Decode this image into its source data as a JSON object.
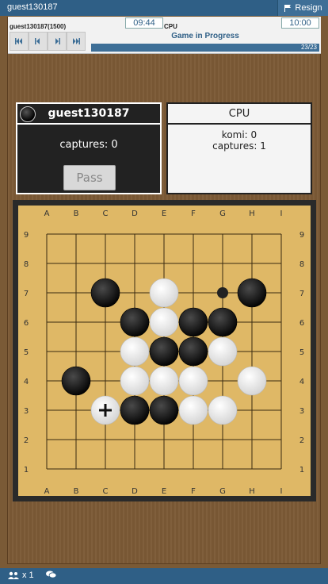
{
  "topbar": {
    "username": "guest130187",
    "resign_label": "Resign"
  },
  "header": {
    "player_name": "guest130187(1500)",
    "opponent_name": "CPU",
    "player_clock": "09:44",
    "opponent_clock": "10:00",
    "status": "Game in Progress",
    "move_counter": "23/23",
    "progress": 1.0
  },
  "player_panel": {
    "name": "guest130187",
    "captures": "captures: 0",
    "pass_label": "Pass"
  },
  "opponent_panel": {
    "name": "CPU",
    "komi": "komi: 0",
    "captures": "captures: 1"
  },
  "board": {
    "size": 9,
    "col_labels": [
      "A",
      "B",
      "C",
      "D",
      "E",
      "F",
      "G",
      "H",
      "I"
    ],
    "row_labels": [
      "9",
      "8",
      "7",
      "6",
      "5",
      "4",
      "3",
      "2",
      "1"
    ],
    "stones": [
      {
        "color": "black",
        "col": "C",
        "row": 7
      },
      {
        "color": "white",
        "col": "E",
        "row": 7
      },
      {
        "color": "black",
        "col": "H",
        "row": 7
      },
      {
        "color": "black",
        "col": "D",
        "row": 6
      },
      {
        "color": "white",
        "col": "E",
        "row": 6
      },
      {
        "color": "black",
        "col": "F",
        "row": 6
      },
      {
        "color": "black",
        "col": "G",
        "row": 6
      },
      {
        "color": "white",
        "col": "D",
        "row": 5
      },
      {
        "color": "black",
        "col": "E",
        "row": 5
      },
      {
        "color": "black",
        "col": "F",
        "row": 5
      },
      {
        "color": "white",
        "col": "G",
        "row": 5
      },
      {
        "color": "black",
        "col": "B",
        "row": 4
      },
      {
        "color": "white",
        "col": "D",
        "row": 4
      },
      {
        "color": "white",
        "col": "E",
        "row": 4
      },
      {
        "color": "white",
        "col": "F",
        "row": 4
      },
      {
        "color": "white",
        "col": "H",
        "row": 4
      },
      {
        "color": "white",
        "col": "C",
        "row": 3
      },
      {
        "color": "black",
        "col": "D",
        "row": 3
      },
      {
        "color": "black",
        "col": "E",
        "row": 3
      },
      {
        "color": "white",
        "col": "F",
        "row": 3
      },
      {
        "color": "white",
        "col": "G",
        "row": 3
      }
    ],
    "small_marker": {
      "col": "G",
      "row": 7
    },
    "last_move": {
      "col": "C",
      "row": 3
    }
  },
  "footer": {
    "users_count": "x 1"
  },
  "icons": [
    "flag-icon",
    "first-move-icon",
    "prev-move-icon",
    "next-move-icon",
    "last-move-icon",
    "users-icon",
    "chat-icon"
  ]
}
